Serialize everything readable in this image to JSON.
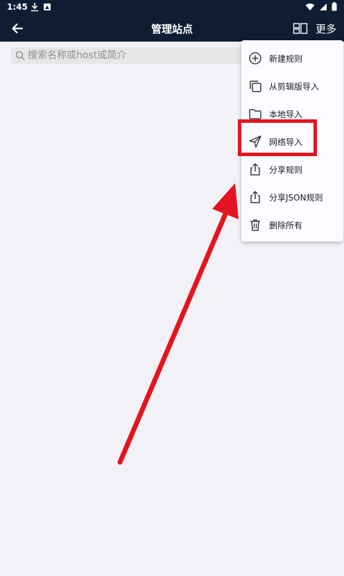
{
  "status_bar": {
    "time": "1:45"
  },
  "app_bar": {
    "title": "管理站点",
    "more_label": "更多"
  },
  "search": {
    "placeholder": "搜索名称或host或简介"
  },
  "menu": {
    "items": [
      {
        "label": "新建规则",
        "icon": "add-circle-icon"
      },
      {
        "label": "从剪辑版导入",
        "icon": "copy-icon"
      },
      {
        "label": "本地导入",
        "icon": "folder-icon"
      },
      {
        "label": "网络导入",
        "icon": "send-icon"
      },
      {
        "label": "分享规则",
        "icon": "share-icon"
      },
      {
        "label": "分享JSON规则",
        "icon": "share-icon"
      },
      {
        "label": "删除所有",
        "icon": "trash-icon"
      }
    ]
  },
  "annotation": {
    "highlight_color": "#e3141f",
    "highlighted_item": "网络导入"
  },
  "colors": {
    "app_bar": "#0f1d33",
    "background": "#f2f1f6",
    "menu_background": "#fdfbff"
  }
}
